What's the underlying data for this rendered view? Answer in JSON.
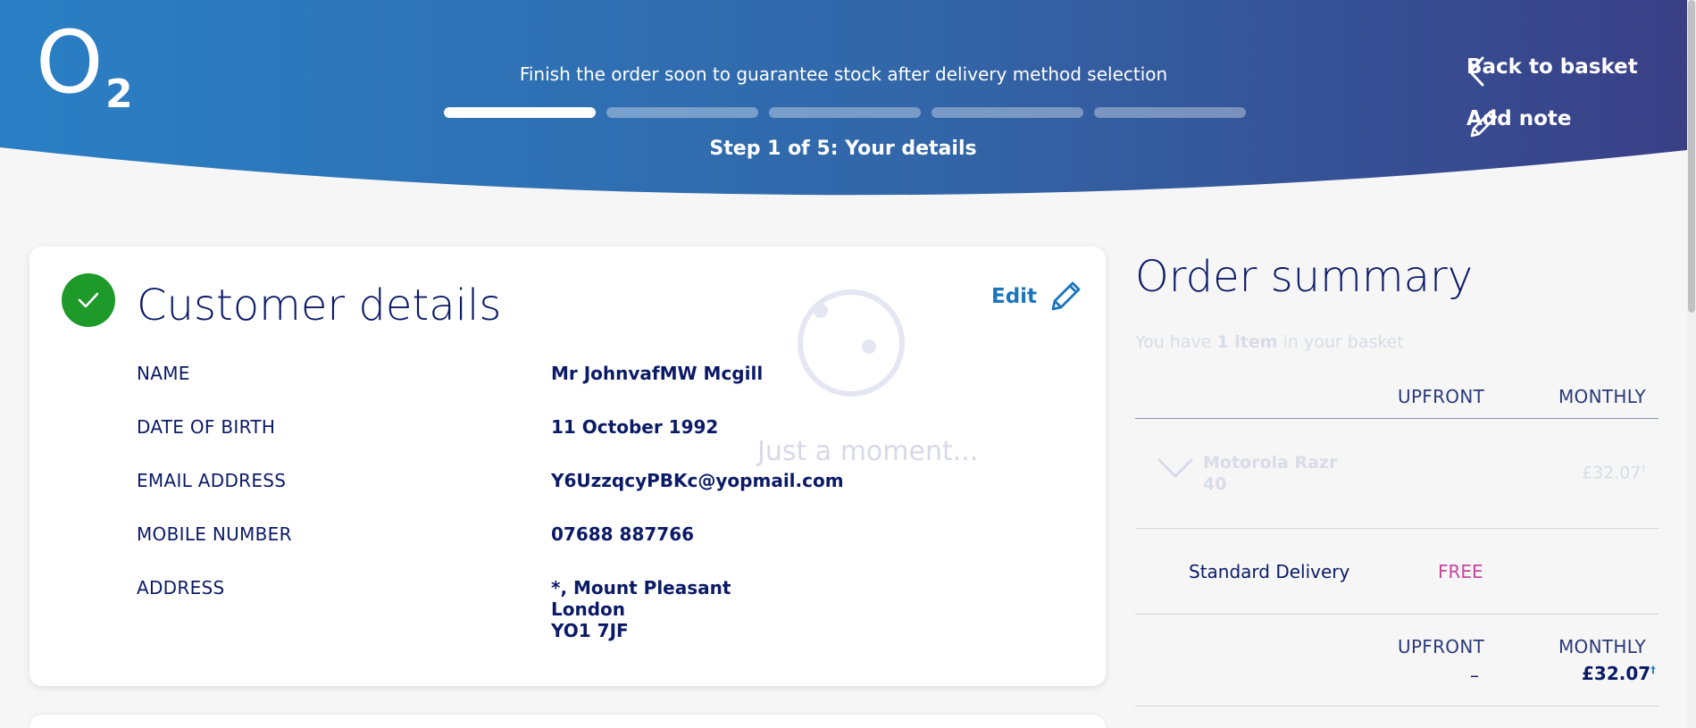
{
  "header": {
    "logo_main": "O",
    "logo_sub": "2",
    "message": "Finish the order soon to guarantee stock after delivery method selection",
    "progress_total": 5,
    "progress_current": 1,
    "step_text": "Step 1 of 5: Your details",
    "back_label": "Back to basket",
    "note_label": "Add note"
  },
  "customer": {
    "title": "Customer details",
    "edit_label": "Edit",
    "loading_text": "Just a moment...",
    "fields": [
      {
        "label": "NAME",
        "value": "Mr JohnvafMW Mcgill"
      },
      {
        "label": "DATE OF BIRTH",
        "value": "11 October 1992"
      },
      {
        "label": "EMAIL ADDRESS",
        "value": "Y6UzzqcyPBKc@yopmail.com"
      },
      {
        "label": "MOBILE NUMBER",
        "value": "07688 887766"
      },
      {
        "label": "ADDRESS",
        "value_lines": [
          "*, Mount Pleasant",
          "London",
          "YO1 7JF"
        ]
      }
    ]
  },
  "summary": {
    "title": "Order summary",
    "sub_prefix": "You have ",
    "sub_bold": "1 item",
    "sub_suffix": " in your basket",
    "col_upfront": "UPFRONT",
    "col_monthly": "MONTHLY",
    "item_name_line1": "Motorola Razr",
    "item_name_line2": "40",
    "item_price": "£32.07",
    "dagger": "†",
    "delivery_label": "Standard Delivery",
    "delivery_price": "FREE",
    "total_upfront": "–",
    "total_monthly": "£32.07"
  },
  "colors": {
    "header_start": "#2a7fc4",
    "header_end": "#3a3f86",
    "brand_text": "#0b1a66",
    "edit_blue": "#1b75bb",
    "check_green": "#1e9a2a",
    "free_pink": "#c5459c"
  }
}
